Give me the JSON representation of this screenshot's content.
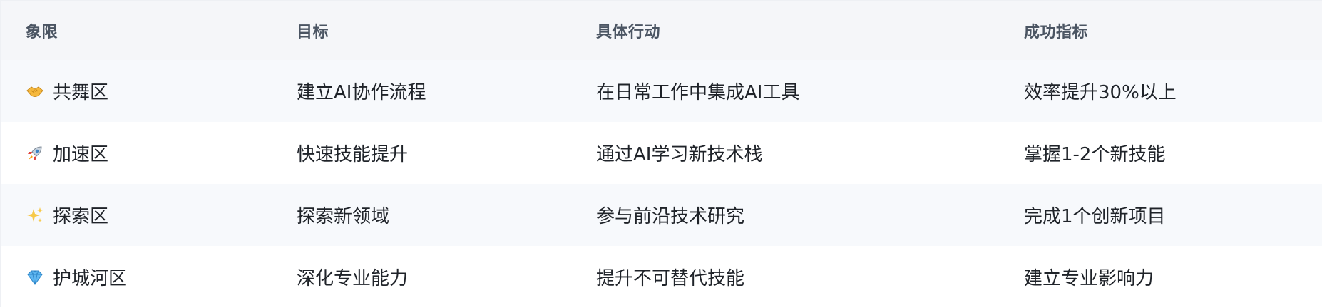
{
  "table": {
    "headers": [
      "象限",
      "目标",
      "具体行动",
      "成功指标"
    ],
    "rows": [
      {
        "icon": "handshake-icon",
        "quadrant": "共舞区",
        "goal": "建立AI协作流程",
        "action": "在日常工作中集成AI工具",
        "metric": "效率提升30%以上"
      },
      {
        "icon": "rocket-icon",
        "quadrant": "加速区",
        "goal": "快速技能提升",
        "action": "通过AI学习新技术栈",
        "metric": "掌握1-2个新技能"
      },
      {
        "icon": "sparkles-icon",
        "quadrant": "探索区",
        "goal": "探索新领域",
        "action": "参与前沿技术研究",
        "metric": "完成1个创新项目"
      },
      {
        "icon": "gem-icon",
        "quadrant": "护城河区",
        "goal": "深化专业能力",
        "action": "提升不可替代技能",
        "metric": "建立专业影响力"
      }
    ]
  }
}
